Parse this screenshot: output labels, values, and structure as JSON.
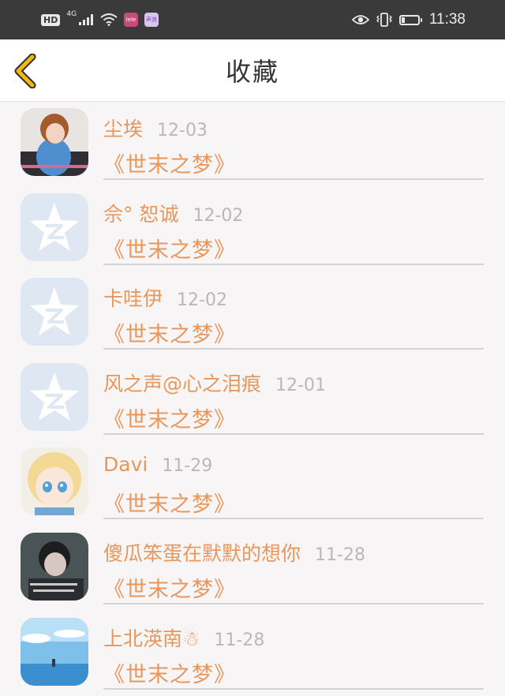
{
  "status_bar": {
    "hd": "HD",
    "network": "4G",
    "app_icon_1": "lele",
    "app_icon_2": "声浪",
    "time": "11:38",
    "battery_level": 0.2,
    "icons": [
      "signal-icon",
      "wifi-icon",
      "eye-icon",
      "vibrate-icon",
      "battery-icon"
    ]
  },
  "header": {
    "title": "收藏",
    "back_icon": "chevron-left-icon",
    "accent_color": "#f2b90f"
  },
  "favorites": [
    {
      "name": "尘埃",
      "date": "12-03",
      "book": "《世末之梦》",
      "avatar": "photo-girl"
    },
    {
      "name": "佘° 恕诚",
      "date": "12-02",
      "book": "《世末之梦》",
      "avatar": "qzone-star"
    },
    {
      "name": "卡哇伊",
      "date": "12-02",
      "book": "《世末之梦》",
      "avatar": "qzone-star"
    },
    {
      "name": "风之声@心之泪痕",
      "date": "12-01",
      "book": "《世末之梦》",
      "avatar": "qzone-star"
    },
    {
      "name": "Davi",
      "date": "11-29",
      "book": "《世末之梦》",
      "avatar": "anime-girl"
    },
    {
      "name": "傻瓜笨蛋在默默的想你",
      "date": "11-28",
      "book": "《世末之梦》",
      "avatar": "photo-boy"
    },
    {
      "name": "上北渶南☃",
      "date": "11-28",
      "book": "《世末之梦》",
      "avatar": "sky-scene"
    }
  ]
}
